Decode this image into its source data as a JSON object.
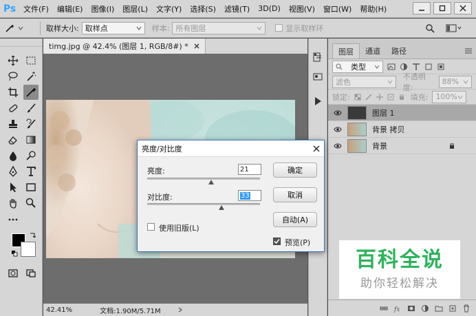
{
  "app": {
    "logo": "Ps"
  },
  "menu": [
    "文件(F)",
    "编辑(E)",
    "图像(I)",
    "图层(L)",
    "文字(Y)",
    "选择(S)",
    "滤镜(T)",
    "3D(D)",
    "视图(V)",
    "窗口(W)",
    "帮助(H)"
  ],
  "options_bar": {
    "sample_size_label": "取样大小:",
    "sample_size_value": "取样点",
    "sample_label": "样本:",
    "sample_value": "所有图层",
    "show_ring_label": "显示取样环"
  },
  "document": {
    "tab_title": "timg.jpg @ 42.4% (图层 1, RGB/8#) *",
    "zoom": "42.41%",
    "doc_info": "文档:1.90M/5.71M"
  },
  "layers_panel": {
    "tabs": [
      "图层",
      "通道",
      "路径"
    ],
    "filter_label": "类型",
    "blend_mode": "滤色",
    "opacity_label": "不透明度:",
    "opacity_value": "88%",
    "lock_label": "锁定:",
    "fill_label": "填充:",
    "fill_value": "100%",
    "layers": [
      {
        "name": "图层 1"
      },
      {
        "name": "背景 拷贝"
      },
      {
        "name": "背景"
      }
    ]
  },
  "dialog": {
    "title": "亮度/对比度",
    "brightness_label": "亮度:",
    "brightness_value": "21",
    "contrast_label": "对比度:",
    "contrast_value": "33",
    "legacy_label": "使用旧版(L)",
    "ok_label": "确定",
    "cancel_label": "取消",
    "auto_label": "自动(A)",
    "preview_label": "预览(P)"
  },
  "watermark": {
    "title": "百科全说",
    "subtitle": "助你轻松解决"
  },
  "colors": {
    "accent": "#31a8ff",
    "watermark_green": "#2db35a",
    "dialog_border": "#3c78b4"
  }
}
